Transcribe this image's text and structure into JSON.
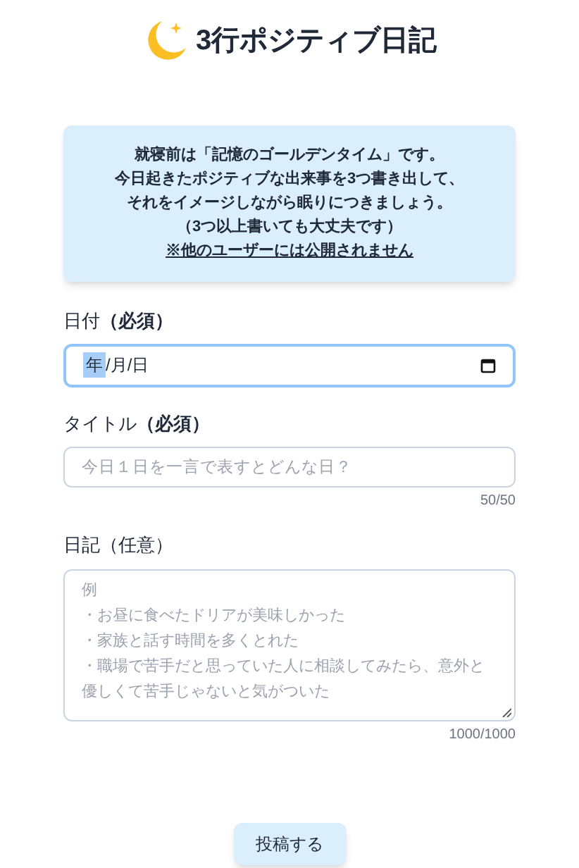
{
  "header": {
    "title": "3行ポジティブ日記"
  },
  "notice": {
    "lines": [
      "就寝前は「記憶のゴールデンタイム」です。",
      "今日起きたポジティブな出来事を3つ書き出して、",
      "それをイメージしながら眠りにつきましょう。",
      "（3つ以上書いても大丈夫です）"
    ],
    "link": "※他のユーザーには公開されません"
  },
  "date_field": {
    "label": "日付",
    "required": "（必須）",
    "year": "年",
    "rest": "/月/日",
    "focused": true
  },
  "title_field": {
    "label": "タイトル",
    "required": "（必須）",
    "placeholder": "今日１日を一言で表すとどんな日？",
    "counter": "50/50"
  },
  "diary_field": {
    "label": "日記（任意）",
    "placeholder_lines": [
      "例",
      "・お昼に食べたドリアが美味しかった",
      "・家族と話す時間を多くとれた",
      "・職場で苦手だと思っていた人に相談してみたら、意外と優しくて苦手じゃないと気がついた"
    ],
    "counter": "1000/1000"
  },
  "submit": {
    "label": "投稿する"
  }
}
